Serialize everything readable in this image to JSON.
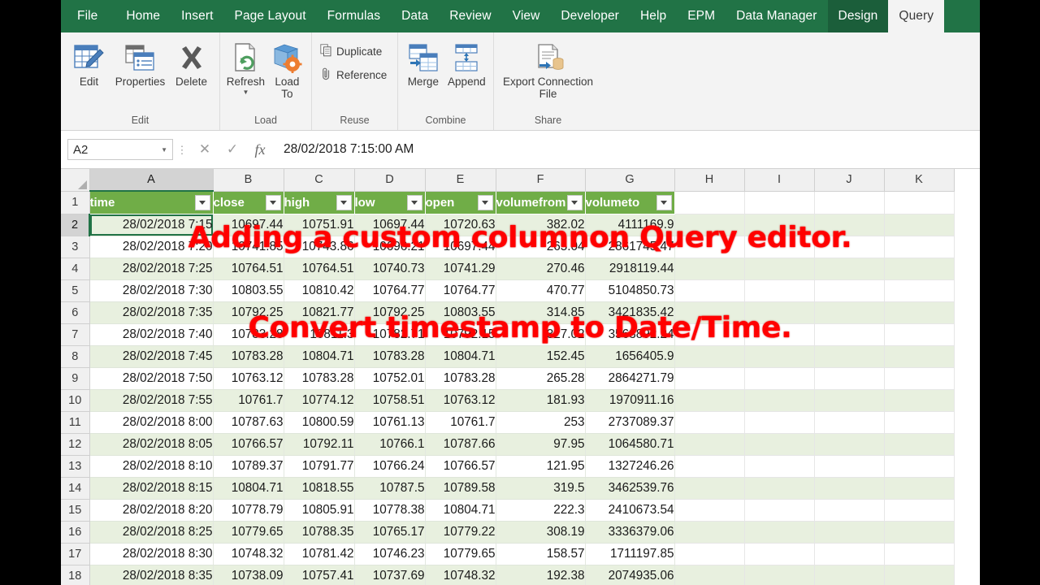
{
  "app": {
    "ribbon_tabs": [
      {
        "label": "File",
        "state": "file"
      },
      {
        "label": "Home",
        "state": "normal"
      },
      {
        "label": "Insert",
        "state": "normal"
      },
      {
        "label": "Page Layout",
        "state": "normal"
      },
      {
        "label": "Formulas",
        "state": "normal"
      },
      {
        "label": "Data",
        "state": "normal"
      },
      {
        "label": "Review",
        "state": "normal"
      },
      {
        "label": "View",
        "state": "normal"
      },
      {
        "label": "Developer",
        "state": "normal"
      },
      {
        "label": "Help",
        "state": "normal"
      },
      {
        "label": "EPM",
        "state": "normal"
      },
      {
        "label": "Data Manager",
        "state": "normal"
      },
      {
        "label": "Design",
        "state": "contextual"
      },
      {
        "label": "Query",
        "state": "active"
      }
    ],
    "ribbon_groups": [
      {
        "label": "Edit",
        "buttons": [
          {
            "label": "Edit",
            "icon": "edit-table-icon"
          },
          {
            "label": "Properties",
            "icon": "properties-icon"
          },
          {
            "label": "Delete",
            "icon": "delete-x-icon"
          }
        ]
      },
      {
        "label": "Load",
        "buttons": [
          {
            "label": "Refresh",
            "icon": "refresh-icon",
            "has_dropdown": true
          },
          {
            "label": "Load To",
            "icon": "load-to-icon"
          }
        ]
      },
      {
        "label": "Reuse",
        "buttons": [
          {
            "label": "Duplicate",
            "icon": "duplicate-icon"
          },
          {
            "label": "Reference",
            "icon": "paperclip-icon"
          }
        ]
      },
      {
        "label": "Combine",
        "buttons": [
          {
            "label": "Merge",
            "icon": "merge-icon"
          },
          {
            "label": "Append",
            "icon": "append-icon"
          }
        ]
      },
      {
        "label": "Share",
        "buttons": [
          {
            "label": "Export Connection File",
            "icon": "export-connection-icon"
          }
        ]
      }
    ],
    "formula_bar": {
      "name_box": "A2",
      "cancel_icon": "cancel-x-icon",
      "confirm_icon": "confirm-check-icon",
      "function_icon": "fx-icon",
      "formula_value": "28/02/2018  7:15:00 AM"
    },
    "colors": {
      "ribbon_green": "#217346",
      "table_header_green": "#70ad47",
      "band_green": "#e8f0df",
      "overlay_red": "#ff0000"
    }
  },
  "sheet": {
    "column_letters": [
      "A",
      "B",
      "C",
      "D",
      "E",
      "F",
      "G",
      "H",
      "I",
      "J",
      "K"
    ],
    "selected_column": "A",
    "selected_row": 2,
    "selected_cell": "A2",
    "table_headers": [
      "time",
      "close",
      "high",
      "low",
      "open",
      "volumefrom",
      "volumeto"
    ],
    "row_numbers": [
      1,
      2,
      3,
      4,
      5,
      6,
      7,
      8,
      9,
      10,
      11,
      12,
      13,
      14,
      15,
      16,
      17,
      18
    ],
    "rows": [
      {
        "n": 2,
        "cells": [
          "28/02/2018 7:15",
          "10697.44",
          "10751.91",
          "10697.44",
          "10720.63",
          "382.02",
          "4111169.9"
        ]
      },
      {
        "n": 3,
        "cells": [
          "28/02/2018 7:20",
          "10741.85",
          "10743.86",
          "10696.21",
          "10697.44",
          "265.04",
          "2861745.47"
        ]
      },
      {
        "n": 4,
        "cells": [
          "28/02/2018 7:25",
          "10764.51",
          "10764.51",
          "10740.73",
          "10741.29",
          "270.46",
          "2918119.44"
        ]
      },
      {
        "n": 5,
        "cells": [
          "28/02/2018 7:30",
          "10803.55",
          "10810.42",
          "10764.77",
          "10764.77",
          "470.77",
          "5104850.73"
        ]
      },
      {
        "n": 6,
        "cells": [
          "28/02/2018 7:35",
          "10792.25",
          "10821.77",
          "10792.25",
          "10803.55",
          "314.85",
          "3421835.42"
        ]
      },
      {
        "n": 7,
        "cells": [
          "28/02/2018 7:40",
          "10783.28",
          "10811.3",
          "10782.71",
          "10792.15",
          "327.02",
          "3563892.24"
        ]
      },
      {
        "n": 8,
        "cells": [
          "28/02/2018 7:45",
          "10783.28",
          "10804.71",
          "10783.28",
          "10804.71",
          "152.45",
          "1656405.9"
        ]
      },
      {
        "n": 9,
        "cells": [
          "28/02/2018 7:50",
          "10763.12",
          "10783.28",
          "10752.01",
          "10783.28",
          "265.28",
          "2864271.79"
        ]
      },
      {
        "n": 10,
        "cells": [
          "28/02/2018 7:55",
          "10761.7",
          "10774.12",
          "10758.51",
          "10763.12",
          "181.93",
          "1970911.16"
        ]
      },
      {
        "n": 11,
        "cells": [
          "28/02/2018 8:00",
          "10787.63",
          "10800.59",
          "10761.13",
          "10761.7",
          "253",
          "2737089.37"
        ]
      },
      {
        "n": 12,
        "cells": [
          "28/02/2018 8:05",
          "10766.57",
          "10792.11",
          "10766.1",
          "10787.66",
          "97.95",
          "1064580.71"
        ]
      },
      {
        "n": 13,
        "cells": [
          "28/02/2018 8:10",
          "10789.37",
          "10791.77",
          "10766.24",
          "10766.57",
          "121.95",
          "1327246.26"
        ]
      },
      {
        "n": 14,
        "cells": [
          "28/02/2018 8:15",
          "10804.71",
          "10818.55",
          "10787.5",
          "10789.58",
          "319.5",
          "3462539.76"
        ]
      },
      {
        "n": 15,
        "cells": [
          "28/02/2018 8:20",
          "10778.79",
          "10805.91",
          "10778.38",
          "10804.71",
          "222.3",
          "2410673.54"
        ]
      },
      {
        "n": 16,
        "cells": [
          "28/02/2018 8:25",
          "10779.65",
          "10788.35",
          "10765.17",
          "10779.22",
          "308.19",
          "3336379.06"
        ]
      },
      {
        "n": 17,
        "cells": [
          "28/02/2018 8:30",
          "10748.32",
          "10781.42",
          "10746.23",
          "10779.65",
          "158.57",
          "1711197.85"
        ]
      },
      {
        "n": 18,
        "cells": [
          "28/02/2018 8:35",
          "10738.09",
          "10757.41",
          "10737.69",
          "10748.32",
          "192.38",
          "2074935.06"
        ]
      }
    ]
  },
  "overlay": {
    "line1": "Adding a custom columnon Query editor.",
    "line2": "Convert timestamp to Date/Time."
  }
}
